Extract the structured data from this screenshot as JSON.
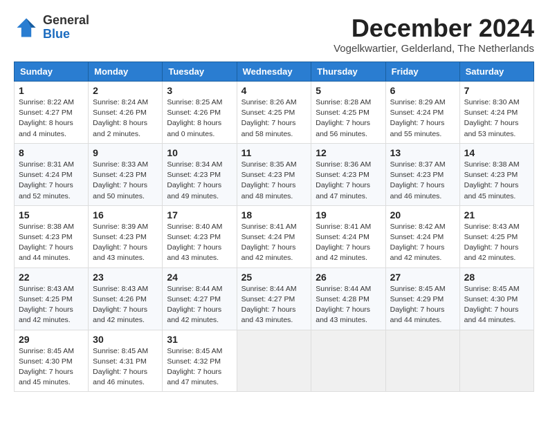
{
  "logo": {
    "general": "General",
    "blue": "Blue"
  },
  "header": {
    "month": "December 2024",
    "location": "Vogelkwartier, Gelderland, The Netherlands"
  },
  "weekdays": [
    "Sunday",
    "Monday",
    "Tuesday",
    "Wednesday",
    "Thursday",
    "Friday",
    "Saturday"
  ],
  "weeks": [
    [
      {
        "day": "1",
        "sunrise": "8:22 AM",
        "sunset": "4:27 PM",
        "daylight": "8 hours and 4 minutes."
      },
      {
        "day": "2",
        "sunrise": "8:24 AM",
        "sunset": "4:26 PM",
        "daylight": "8 hours and 2 minutes."
      },
      {
        "day": "3",
        "sunrise": "8:25 AM",
        "sunset": "4:26 PM",
        "daylight": "8 hours and 0 minutes."
      },
      {
        "day": "4",
        "sunrise": "8:26 AM",
        "sunset": "4:25 PM",
        "daylight": "7 hours and 58 minutes."
      },
      {
        "day": "5",
        "sunrise": "8:28 AM",
        "sunset": "4:25 PM",
        "daylight": "7 hours and 56 minutes."
      },
      {
        "day": "6",
        "sunrise": "8:29 AM",
        "sunset": "4:24 PM",
        "daylight": "7 hours and 55 minutes."
      },
      {
        "day": "7",
        "sunrise": "8:30 AM",
        "sunset": "4:24 PM",
        "daylight": "7 hours and 53 minutes."
      }
    ],
    [
      {
        "day": "8",
        "sunrise": "8:31 AM",
        "sunset": "4:24 PM",
        "daylight": "7 hours and 52 minutes."
      },
      {
        "day": "9",
        "sunrise": "8:33 AM",
        "sunset": "4:23 PM",
        "daylight": "7 hours and 50 minutes."
      },
      {
        "day": "10",
        "sunrise": "8:34 AM",
        "sunset": "4:23 PM",
        "daylight": "7 hours and 49 minutes."
      },
      {
        "day": "11",
        "sunrise": "8:35 AM",
        "sunset": "4:23 PM",
        "daylight": "7 hours and 48 minutes."
      },
      {
        "day": "12",
        "sunrise": "8:36 AM",
        "sunset": "4:23 PM",
        "daylight": "7 hours and 47 minutes."
      },
      {
        "day": "13",
        "sunrise": "8:37 AM",
        "sunset": "4:23 PM",
        "daylight": "7 hours and 46 minutes."
      },
      {
        "day": "14",
        "sunrise": "8:38 AM",
        "sunset": "4:23 PM",
        "daylight": "7 hours and 45 minutes."
      }
    ],
    [
      {
        "day": "15",
        "sunrise": "8:38 AM",
        "sunset": "4:23 PM",
        "daylight": "7 hours and 44 minutes."
      },
      {
        "day": "16",
        "sunrise": "8:39 AM",
        "sunset": "4:23 PM",
        "daylight": "7 hours and 43 minutes."
      },
      {
        "day": "17",
        "sunrise": "8:40 AM",
        "sunset": "4:23 PM",
        "daylight": "7 hours and 43 minutes."
      },
      {
        "day": "18",
        "sunrise": "8:41 AM",
        "sunset": "4:24 PM",
        "daylight": "7 hours and 42 minutes."
      },
      {
        "day": "19",
        "sunrise": "8:41 AM",
        "sunset": "4:24 PM",
        "daylight": "7 hours and 42 minutes."
      },
      {
        "day": "20",
        "sunrise": "8:42 AM",
        "sunset": "4:24 PM",
        "daylight": "7 hours and 42 minutes."
      },
      {
        "day": "21",
        "sunrise": "8:43 AM",
        "sunset": "4:25 PM",
        "daylight": "7 hours and 42 minutes."
      }
    ],
    [
      {
        "day": "22",
        "sunrise": "8:43 AM",
        "sunset": "4:25 PM",
        "daylight": "7 hours and 42 minutes."
      },
      {
        "day": "23",
        "sunrise": "8:43 AM",
        "sunset": "4:26 PM",
        "daylight": "7 hours and 42 minutes."
      },
      {
        "day": "24",
        "sunrise": "8:44 AM",
        "sunset": "4:27 PM",
        "daylight": "7 hours and 42 minutes."
      },
      {
        "day": "25",
        "sunrise": "8:44 AM",
        "sunset": "4:27 PM",
        "daylight": "7 hours and 43 minutes."
      },
      {
        "day": "26",
        "sunrise": "8:44 AM",
        "sunset": "4:28 PM",
        "daylight": "7 hours and 43 minutes."
      },
      {
        "day": "27",
        "sunrise": "8:45 AM",
        "sunset": "4:29 PM",
        "daylight": "7 hours and 44 minutes."
      },
      {
        "day": "28",
        "sunrise": "8:45 AM",
        "sunset": "4:30 PM",
        "daylight": "7 hours and 44 minutes."
      }
    ],
    [
      {
        "day": "29",
        "sunrise": "8:45 AM",
        "sunset": "4:30 PM",
        "daylight": "7 hours and 45 minutes."
      },
      {
        "day": "30",
        "sunrise": "8:45 AM",
        "sunset": "4:31 PM",
        "daylight": "7 hours and 46 minutes."
      },
      {
        "day": "31",
        "sunrise": "8:45 AM",
        "sunset": "4:32 PM",
        "daylight": "7 hours and 47 minutes."
      },
      null,
      null,
      null,
      null
    ]
  ],
  "labels": {
    "sunrise": "Sunrise: ",
    "sunset": "Sunset: ",
    "daylight": "Daylight: "
  }
}
